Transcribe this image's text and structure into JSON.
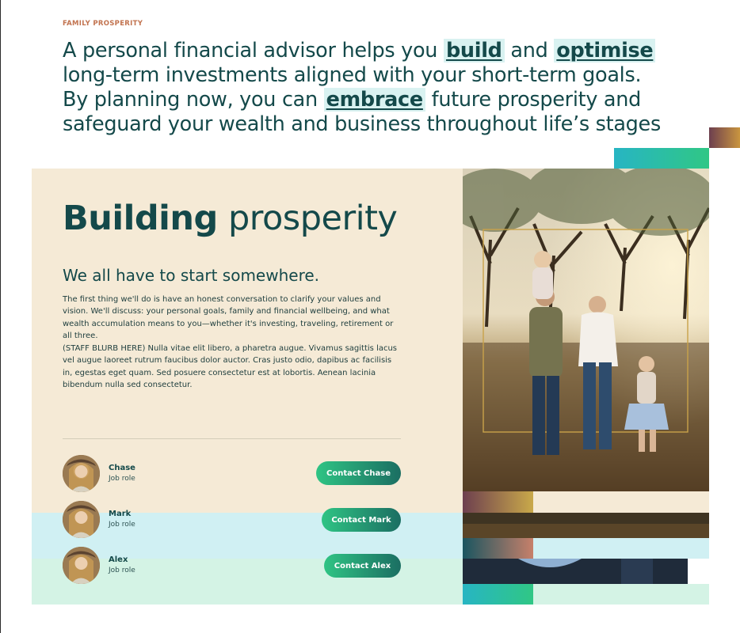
{
  "eyebrow": "FAMILY PROSPERITY",
  "intro": {
    "line1_a": "A personal financial advisor helps you ",
    "hl_build": "build",
    "line1_b": " and ",
    "hl_optimise": "optimise",
    "line2": "long-term investments aligned with your short-term goals.",
    "line3_a": "By planning now, you can ",
    "hl_embrace": "embrace",
    "line3_b": " future prosperity and",
    "line4": "safeguard your wealth and business throughout life’s stages"
  },
  "section": {
    "title_bold": "Building",
    "title_rest": " prosperity",
    "subtitle": "We all have to start somewhere.",
    "para1": "The first thing we'll do is have an honest conversation to clarify your values and vision. We'll discuss: your personal goals, family and financial wellbeing, and what wealth accumulation means to you—whether it's investing, traveling, retirement or all three.",
    "para2": "(STAFF BLURB HERE) Nulla vitae elit libero, a pharetra augue. Vivamus sagittis lacus vel augue laoreet rutrum faucibus dolor auctor. Cras justo odio, dapibus ac facilisis in, egestas eget quam. Sed posuere consectetur est at lobortis. Aenean lacinia bibendum nulla sed consectetur."
  },
  "people": [
    {
      "name": "Chase",
      "role": "Job role",
      "button": "Contact Chase"
    },
    {
      "name": "Mark",
      "role": "Job role",
      "button": "Contact Mark"
    },
    {
      "name": "Alex",
      "role": "Job role",
      "button": "Contact Alex"
    }
  ],
  "colors": {
    "primary": "#14494a",
    "accent": "#c2734f",
    "panel": "#f5ead6",
    "cyan_band": "#d0f0f3",
    "mint_band": "#d4f3e5",
    "button_from": "#2fc484",
    "button_to": "#1b6e62"
  }
}
